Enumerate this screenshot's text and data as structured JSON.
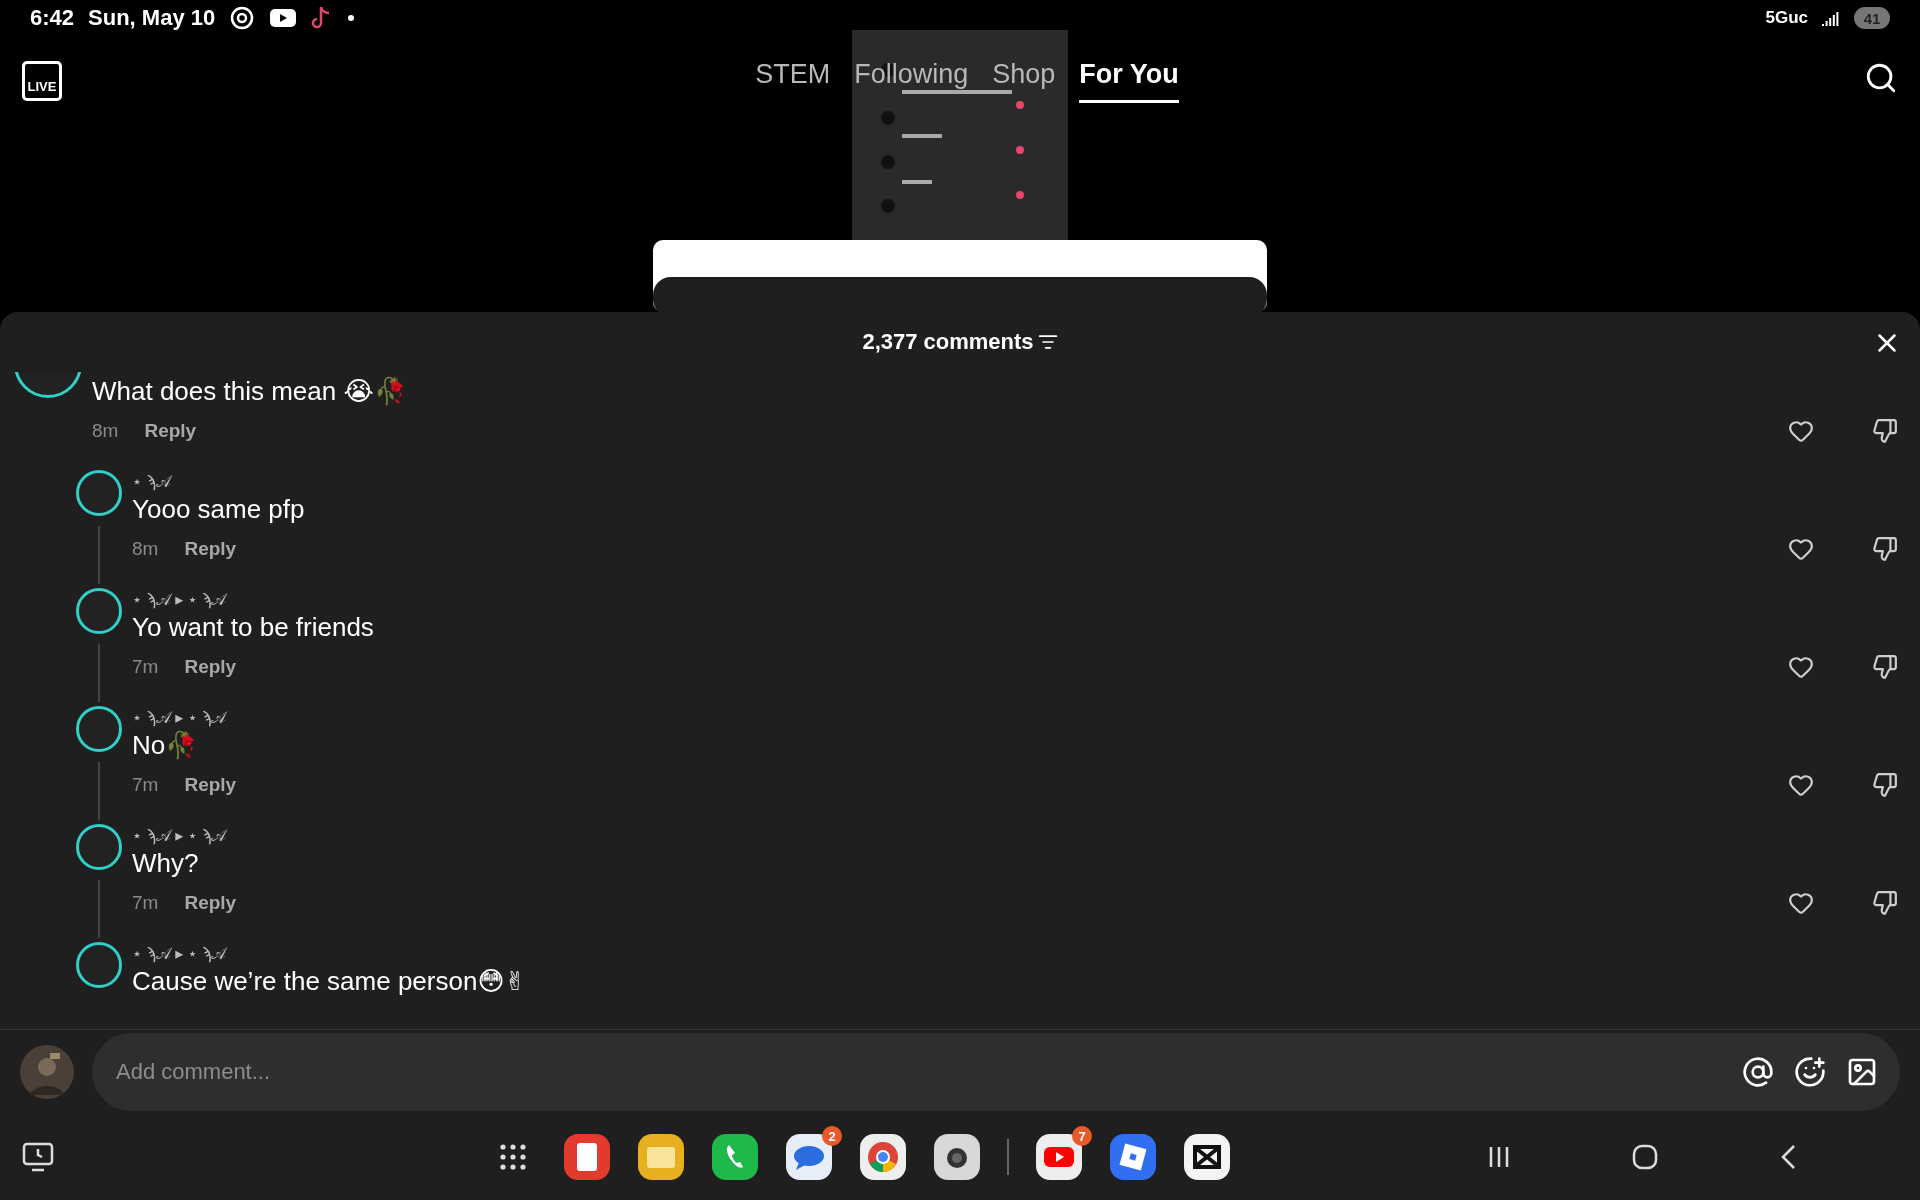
{
  "status_bar": {
    "time": "6:42",
    "date": "Sun, May 10",
    "network": "5Guc",
    "battery": "41"
  },
  "top_nav": {
    "live_label": "LIVE",
    "tabs": [
      {
        "label": "STEM",
        "selected": false
      },
      {
        "label": "Following",
        "selected": false
      },
      {
        "label": "Shop",
        "selected": false
      },
      {
        "label": "For You",
        "selected": true
      }
    ]
  },
  "comments_sheet": {
    "title": "2,377 comments",
    "comments": [
      {
        "kind": "comment",
        "text": "What does this mean 😭🥀",
        "time": "8m",
        "reply_label": "Reply"
      },
      {
        "kind": "reply",
        "username": "⋆ ϡ𝒜",
        "text": "Yooo same pfp",
        "time": "8m",
        "reply_label": "Reply"
      },
      {
        "kind": "reply",
        "username": "⋆ ϡ𝒜 ▸ ⋆ ϡ𝒜",
        "text": "Yo want to be friends",
        "time": "7m",
        "reply_label": "Reply"
      },
      {
        "kind": "reply",
        "username": "⋆ ϡ𝒜 ▸ ⋆ ϡ𝒜",
        "text": "No🥀",
        "time": "7m",
        "reply_label": "Reply"
      },
      {
        "kind": "reply",
        "username": "⋆ ϡ𝒜 ▸ ⋆ ϡ𝒜",
        "text": "Why?",
        "time": "7m",
        "reply_label": "Reply"
      },
      {
        "kind": "reply",
        "username": "⋆ ϡ𝒜 ▸ ⋆ ϡ𝒜",
        "text": "Cause we’re the same person😳✌"
      }
    ],
    "input": {
      "placeholder": "Add comment..."
    }
  },
  "dock": {
    "apps": [
      {
        "kind": "apps"
      },
      {
        "kind": "notes"
      },
      {
        "kind": "files"
      },
      {
        "kind": "phone"
      },
      {
        "kind": "messages",
        "badge": "2"
      },
      {
        "kind": "chrome"
      },
      {
        "kind": "camera"
      },
      {
        "kind": "divider"
      },
      {
        "kind": "youtube",
        "badge": "7"
      },
      {
        "kind": "roblox"
      },
      {
        "kind": "capcut"
      }
    ]
  }
}
